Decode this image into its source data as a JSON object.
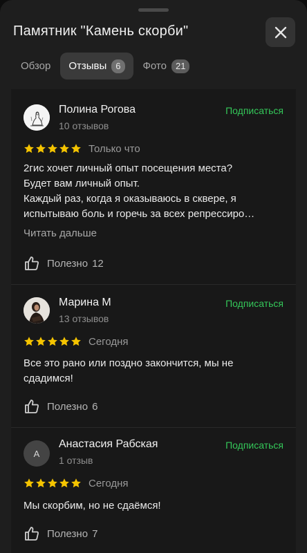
{
  "header": {
    "title": "Памятник \"Камень скорби\"",
    "close_icon": "close-icon"
  },
  "tabs": [
    {
      "label": "Обзор",
      "count": null,
      "active": false
    },
    {
      "label": "Отзывы",
      "count": "6",
      "active": true
    },
    {
      "label": "Фото",
      "count": "21",
      "active": false
    }
  ],
  "reviews": [
    {
      "author": "Полина Рогова",
      "reviews_count": "10 отзывов",
      "subscribe": "Подписаться",
      "rating": 5,
      "date": "Только что",
      "text": "2гис хочет личный опыт посещения места?\nБудет вам личный опыт.\nКаждый раз, когда я оказываюсь в сквере, я\nиспытываю боль и горечь за всех репрессиро…",
      "read_more": "Читать дальше",
      "useful_label": "Полезно",
      "useful_count": "12",
      "avatar": "sketch-avatar"
    },
    {
      "author": "Марина М",
      "reviews_count": "13 отзывов",
      "subscribe": "Подписаться",
      "rating": 5,
      "date": "Сегодня",
      "text": "Все это рано или поздно закончится, мы не\nсдадимся!",
      "useful_label": "Полезно",
      "useful_count": "6",
      "avatar": "photo-avatar"
    },
    {
      "author": "Анастасия Рабская",
      "reviews_count": "1 отзыв",
      "subscribe": "Подписаться",
      "rating": 5,
      "date": "Сегодня",
      "text": "Мы скорбим, но не сдаёмся!",
      "useful_label": "Полезно",
      "useful_count": "7",
      "avatar_letter": "А"
    }
  ],
  "colors": {
    "accent_green": "#34c759",
    "star_yellow": "#f5c400",
    "background": "#1e1e1e"
  }
}
